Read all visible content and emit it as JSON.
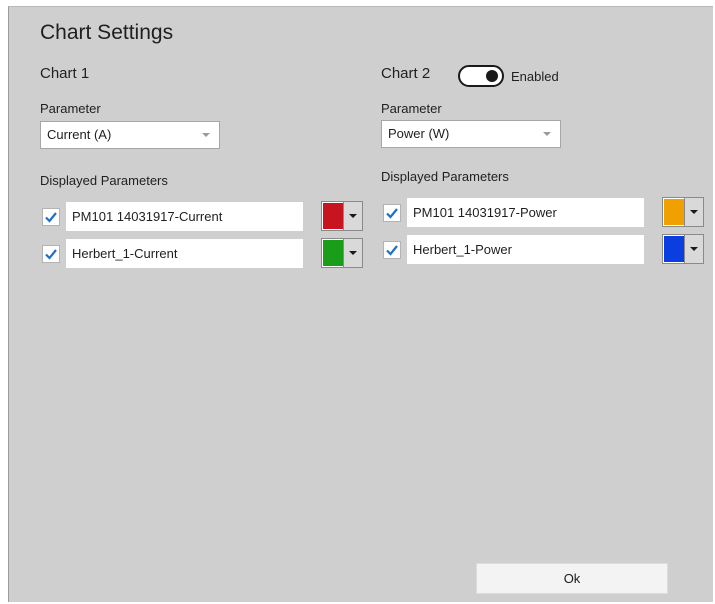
{
  "dialog": {
    "title": "Chart Settings",
    "ok_label": "Ok"
  },
  "chart1": {
    "heading": "Chart 1",
    "parameter_label": "Parameter",
    "parameter_value": "Current (A)",
    "displayed_label": "Displayed Parameters",
    "items": [
      {
        "label": "PM101 14031917-Current",
        "checked": true,
        "color": "#c8141e"
      },
      {
        "label": "Herbert_1-Current",
        "checked": true,
        "color": "#1a9e1a"
      }
    ]
  },
  "chart2": {
    "heading": "Chart 2",
    "toggle_label": "Enabled",
    "toggle_on": true,
    "parameter_label": "Parameter",
    "parameter_value": "Power (W)",
    "displayed_label": "Displayed Parameters",
    "items": [
      {
        "label": "PM101 14031917-Power",
        "checked": true,
        "color": "#f0a000"
      },
      {
        "label": "Herbert_1-Power",
        "checked": true,
        "color": "#0a3ee0"
      }
    ]
  },
  "colors": {
    "check_mark": "#1e6fc8",
    "dialog_bg": "#cfcfcf"
  }
}
